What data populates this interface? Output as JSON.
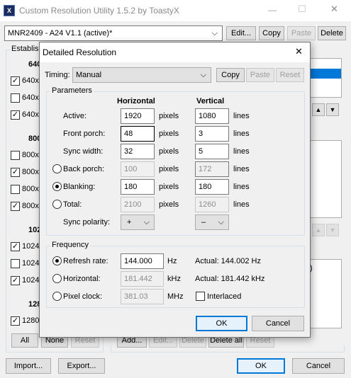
{
  "main": {
    "title": "Custom Resolution Utility 1.5.2 by ToastyX",
    "window_controls": {
      "minimize": "—",
      "maximize": "☐",
      "close": "✕"
    },
    "monitor": "MNR2409 - A24 V1.1 (active)*",
    "buttons": {
      "edit": "Edit...",
      "copy": "Copy",
      "paste": "Paste",
      "delete": "Delete"
    },
    "established_label": "Establis",
    "groups": [
      {
        "header": "640",
        "items": [
          {
            "label": "640x",
            "checked": true
          },
          {
            "label": "640x",
            "checked": false
          },
          {
            "label": "640x",
            "checked": true
          }
        ]
      },
      {
        "header": "800",
        "items": [
          {
            "label": "800x",
            "checked": false
          },
          {
            "label": "800x",
            "checked": true
          },
          {
            "label": "800x",
            "checked": false
          },
          {
            "label": "800x",
            "checked": true
          }
        ]
      },
      {
        "header": "102",
        "items": [
          {
            "label": "1024",
            "checked": true
          },
          {
            "label": "1024",
            "checked": false
          },
          {
            "label": "1024",
            "checked": true
          }
        ]
      },
      {
        "header": "128",
        "items": [
          {
            "label": "1280",
            "checked": true
          }
        ]
      }
    ],
    "all_btn": "All",
    "none_btn": "None",
    "reset_btn": "Reset",
    "list_buttons": {
      "add": "Add...",
      "edit": "Edit...",
      "delete": "Delete",
      "delete_all": "Delete all",
      "reset": "Reset"
    },
    "right_fragment": ")",
    "import": "Import...",
    "export": "Export...",
    "ok": "OK",
    "cancel": "Cancel"
  },
  "dialog": {
    "title": "Detailed Resolution",
    "close": "✕",
    "timing_label": "Timing:",
    "timing_value": "Manual",
    "copy": "Copy",
    "paste": "Paste",
    "reset": "Reset",
    "parameters_label": "Parameters",
    "horizontal_header": "Horizontal",
    "vertical_header": "Vertical",
    "rows": {
      "active": {
        "label": "Active:",
        "h": "1920",
        "v": "1080"
      },
      "front_porch": {
        "label": "Front porch:",
        "h": "48",
        "v": "3"
      },
      "sync_width": {
        "label": "Sync width:",
        "h": "32",
        "v": "5"
      },
      "back_porch": {
        "label": "Back porch:",
        "h": "100",
        "v": "172"
      },
      "blanking": {
        "label": "Blanking:",
        "h": "180",
        "v": "180"
      },
      "total": {
        "label": "Total:",
        "h": "2100",
        "v": "1260"
      }
    },
    "units": {
      "pixels": "pixels",
      "lines": "lines"
    },
    "sync_polarity_label": "Sync polarity:",
    "h_polarity": "+",
    "v_polarity": "–",
    "frequency_label": "Frequency",
    "refresh_label": "Refresh rate:",
    "refresh_value": "144.000",
    "refresh_unit": "Hz",
    "refresh_actual": "Actual: 144.002 Hz",
    "horizontal_label": "Horizontal:",
    "horizontal_value": "181.442",
    "horizontal_unit": "kHz",
    "horizontal_actual": "Actual: 181.442 kHz",
    "pixel_clock_label": "Pixel clock:",
    "pixel_clock_value": "381.03",
    "pixel_clock_unit": "MHz",
    "interlaced_label": "Interlaced",
    "ok": "OK",
    "cancel": "Cancel"
  }
}
